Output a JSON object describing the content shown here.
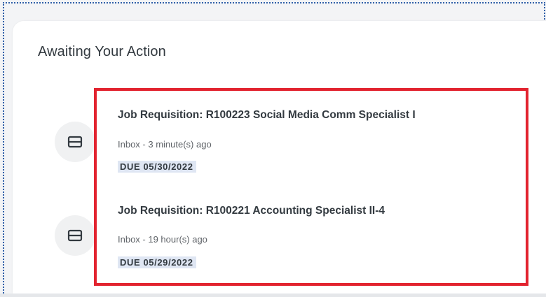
{
  "card": {
    "title": "Awaiting Your Action"
  },
  "items": [
    {
      "title": "Job Requisition: R100223 Social Media Comm Specialist I",
      "meta": "Inbox - 3 minute(s) ago",
      "due": "DUE 05/30/2022",
      "icon": "inbox-icon"
    },
    {
      "title": "Job Requisition: R100221 Accounting Specialist II-4",
      "meta": "Inbox - 19 hour(s) ago",
      "due": "DUE 05/29/2022",
      "icon": "inbox-icon"
    }
  ],
  "colors": {
    "highlight_border": "#e2232f",
    "due_badge_bg": "#dfe6f3",
    "frame_dotted": "#2f5fa8"
  }
}
